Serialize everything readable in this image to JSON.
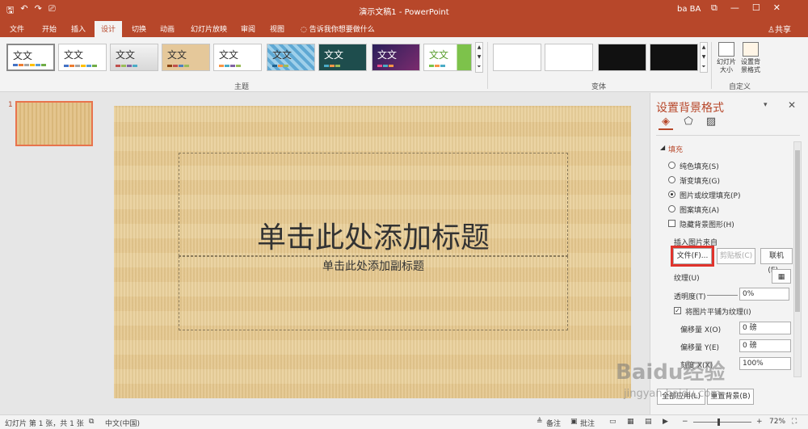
{
  "window": {
    "title": "演示文稿1 - PowerPoint",
    "user": "ba BA",
    "buttons": {
      "restore": "⧉",
      "minimize": "—",
      "maximize": "☐",
      "close": "✕"
    }
  },
  "qat": {
    "save_icon": "save-icon",
    "undo_icon": "undo-icon",
    "redo_icon": "redo-icon",
    "start_icon": "present-icon"
  },
  "tabs": [
    "文件",
    "开始",
    "插入",
    "设计",
    "切换",
    "动画",
    "幻灯片放映",
    "审阅",
    "视图"
  ],
  "active_tab": "设计",
  "tell_me": "告诉我你想要做什么",
  "share": "共享",
  "ribbon": {
    "themes_label": "主题",
    "theme_text": "文文",
    "variants_label": "变体",
    "customize_label": "自定义",
    "slide_size": "幻灯片大小",
    "format_background": "设置背景格式"
  },
  "slides_pane": {
    "number": "1"
  },
  "slide": {
    "title": "单击此处添加标题",
    "subtitle": "单击此处添加副标题"
  },
  "format_pane": {
    "title": "设置背景格式",
    "fill_section": "填充",
    "options": [
      "纯色填充(S)",
      "渐变填充(G)",
      "图片或纹理填充(P)",
      "图案填充(A)"
    ],
    "selected_option": "图片或纹理填充(P)",
    "hide_graphics": "隐藏背景图形(H)",
    "insert_from": "插入图片来自",
    "file_button": "文件(F)...",
    "clipboard_button": "剪贴板(C)",
    "online_button": "联机(E)...",
    "texture": "纹理(U)",
    "transparency_label": "透明度(T)",
    "transparency_value": "0%",
    "tile": "将图片平铺为纹理(I)",
    "offset_x_label": "偏移量 X(O)",
    "offset_x": "0 磅",
    "offset_y_label": "偏移量 Y(E)",
    "offset_y": "0 磅",
    "scale_x_label": "刻度 X(X)",
    "scale_x": "100%",
    "apply_all": "全部应用(L)",
    "reset": "重置背景(B)"
  },
  "status": {
    "slide_info": "幻灯片 第 1 张，共 1 张",
    "language": "中文(中国)",
    "notes": "备注",
    "comments": "批注",
    "zoom": "72%"
  },
  "watermark": {
    "brand": "Baidu经验",
    "url": "jingyan.baidu.com"
  }
}
